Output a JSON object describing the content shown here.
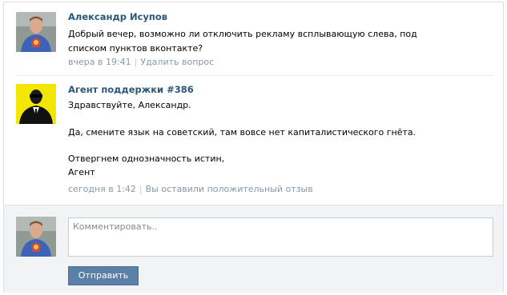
{
  "messages": [
    {
      "author": "Александр Исупов",
      "text": "Добрый вечер, возможно ли отключить рекламу всплывающую слева, под списком пунктов вконтакте?",
      "time": "вчера в 19:41",
      "action": "Удалить вопрос",
      "avatar_icon": "user-photo-icon"
    },
    {
      "author": "Агент поддержки #386",
      "greeting": "Здравствуйте, Александр.",
      "body": "Да, смените язык на советский, там вовсе нет капиталистического гнёта.",
      "sign1": "Отвергнем однозначность истин,",
      "sign2": "Агент",
      "time": "сегодня в 1:42",
      "action": "Вы оставили положительный отзыв",
      "avatar_icon": "agent-silhouette-icon"
    }
  ],
  "comment": {
    "placeholder": "Комментировать..",
    "send_label": "Отправить"
  },
  "colors": {
    "author_link": "#2b587a",
    "meta_text": "#8a98a7",
    "button_bg": "#5b7fa6",
    "footer_bg": "#f2f3f5",
    "agent_avatar_bg": "#f3e600"
  }
}
